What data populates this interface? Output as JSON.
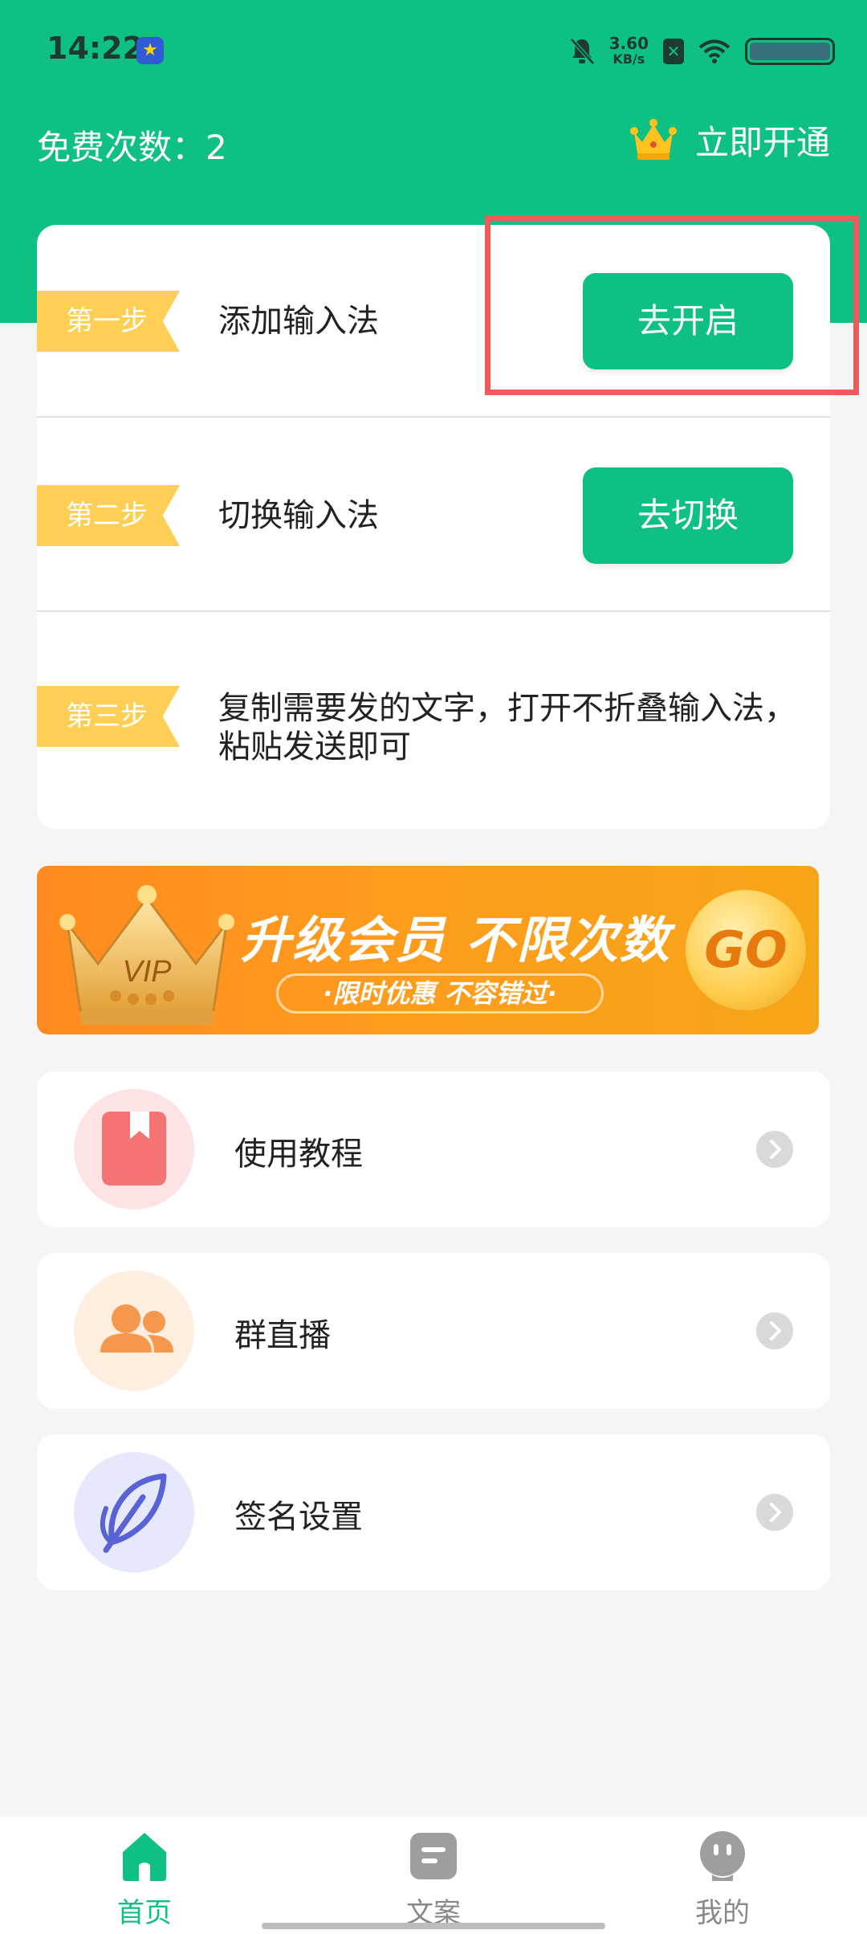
{
  "status_bar": {
    "time": "14:22",
    "net_speed_value": "3.60",
    "net_speed_unit": "KB/s"
  },
  "header": {
    "free_count_label": "免费次数：2",
    "open_now_label": "立即开通"
  },
  "steps": [
    {
      "tag": "第一步",
      "text": "添加输入法",
      "button": "去开启"
    },
    {
      "tag": "第二步",
      "text": "切换输入法",
      "button": "去切换"
    },
    {
      "tag": "第三步",
      "text_line1": "复制需要发的文字，打开不折叠输入法，",
      "text_line2": "粘贴发送即可"
    }
  ],
  "banner": {
    "title": "升级会员 不限次数",
    "subtitle": "·限时优惠  不容错过·",
    "crown_text": "VIP",
    "go_text": "GO"
  },
  "menu": [
    {
      "label": "使用教程",
      "icon": "bookmark-icon"
    },
    {
      "label": "群直播",
      "icon": "group-icon"
    },
    {
      "label": "签名设置",
      "icon": "feather-icon"
    }
  ],
  "tabs": [
    {
      "label": "首页",
      "icon": "home-icon",
      "active": true
    },
    {
      "label": "文案",
      "icon": "document-icon",
      "active": false
    },
    {
      "label": "我的",
      "icon": "profile-icon",
      "active": false
    }
  ],
  "colors": {
    "brand_green": "#0fc083",
    "step_tag": "#ffcf55",
    "highlight_red": "#f05a5a",
    "banner_orange": "#ff8a1f"
  }
}
